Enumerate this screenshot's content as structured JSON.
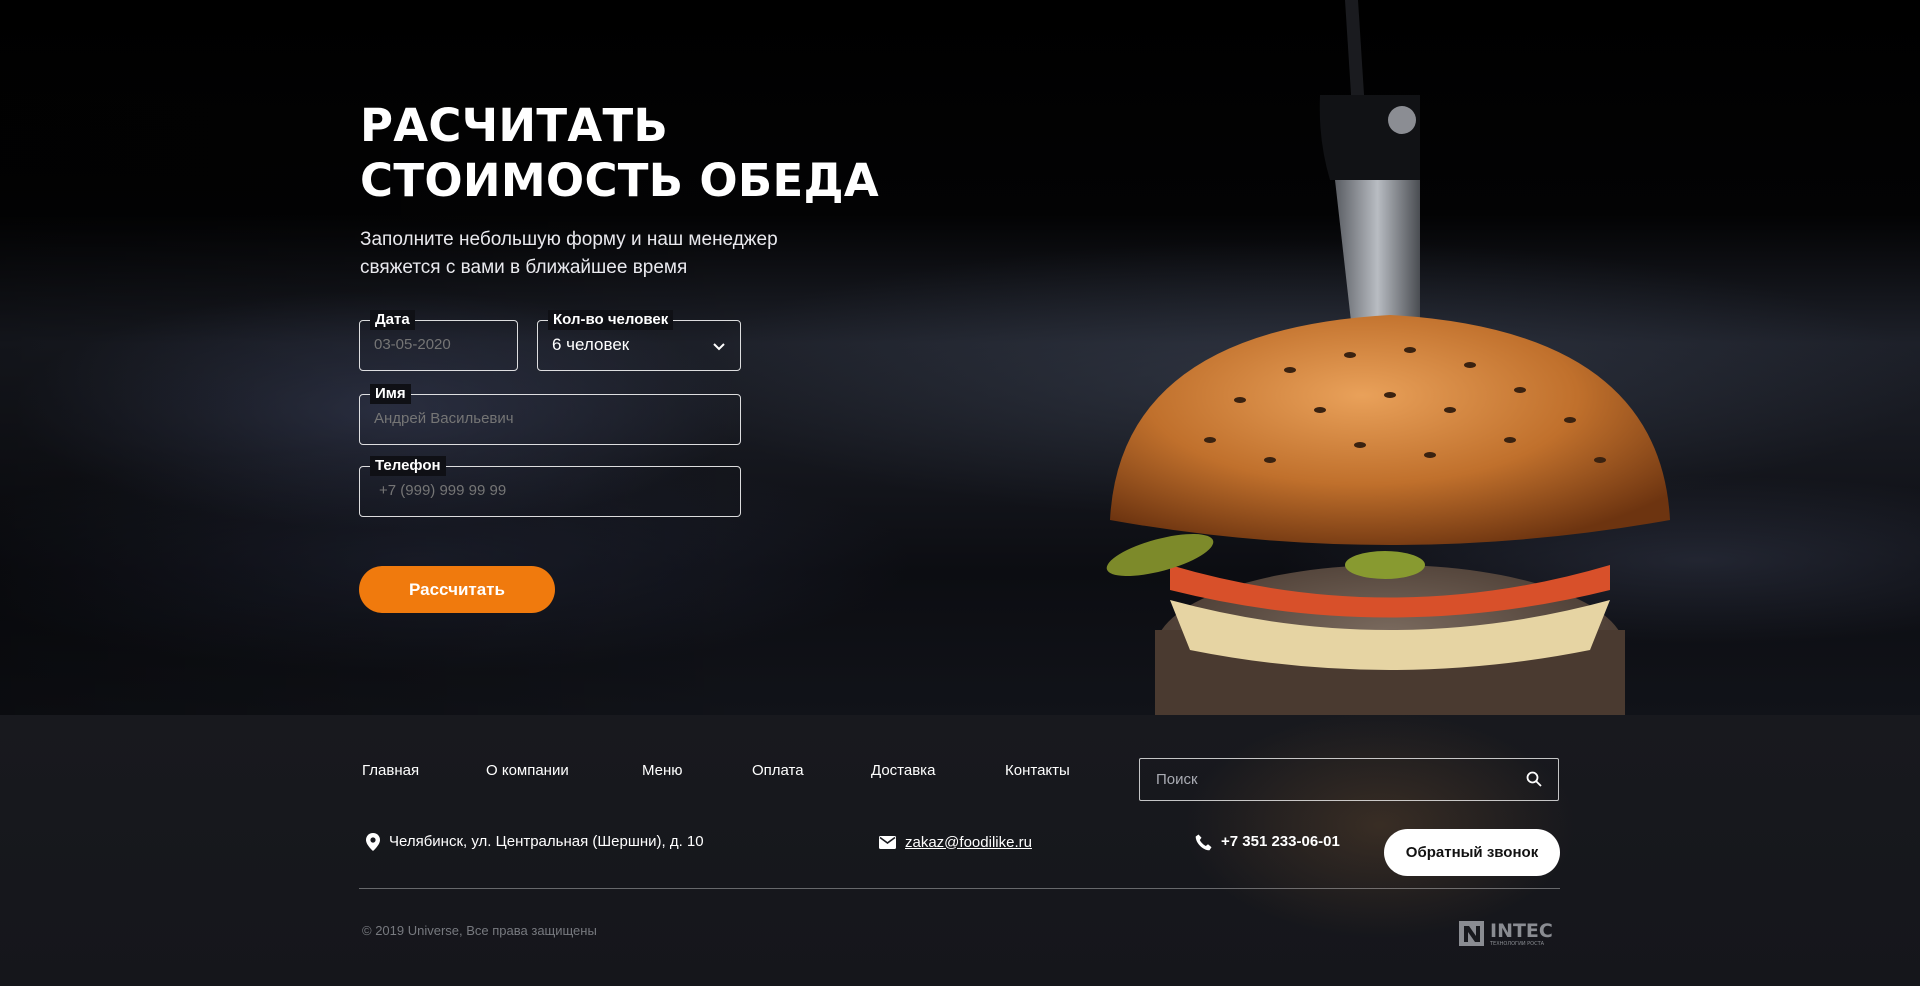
{
  "hero": {
    "title": "РАСЧИТАТЬ\nСТОИМОСТЬ ОБЕДА",
    "subtitle": "Заполните небольшую форму и наш менеджер свяжется с вами в ближайшее время"
  },
  "form": {
    "date": {
      "label": "Дата",
      "placeholder": "03-05-2020"
    },
    "guests": {
      "label": "Кол-во человек",
      "value": "6 человек"
    },
    "name": {
      "label": "Имя",
      "placeholder": "Андрей Васильевич"
    },
    "phone": {
      "label": "Телефон",
      "placeholder": "+7 (999) 999 99 99"
    },
    "submit_label": "Рассчитать"
  },
  "footer": {
    "nav": [
      "Главная",
      "О компании",
      "Меню",
      "Оплата",
      "Доставка",
      "Контакты"
    ],
    "search_placeholder": "Поиск",
    "address": "Челябинск, ул. Центральная (Шершни), д. 10",
    "email": "zakaz@foodilike.ru",
    "phone": "+7 351 233-06-01",
    "callback_label": "Обратный звонок",
    "copyright": "© 2019 Universe, Все права защищены",
    "logo_text": "INTEC",
    "logo_tagline": "ТЕХНОЛОГИИ РОСТА"
  },
  "colors": {
    "accent": "#f07a0d",
    "background": "#0b0b0d",
    "footer": "#17181d"
  },
  "icons": [
    "chevron-down-icon",
    "search-icon",
    "map-pin-icon",
    "mail-icon",
    "phone-icon",
    "intec-logo"
  ]
}
